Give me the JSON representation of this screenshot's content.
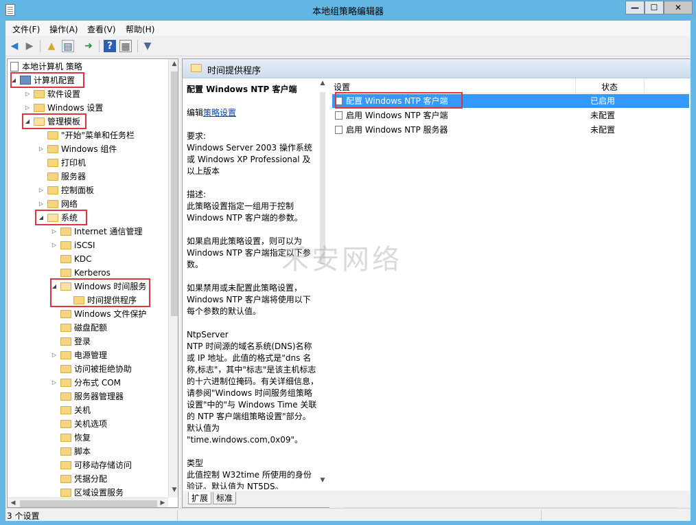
{
  "window": {
    "title": "本地组策略编辑器",
    "min_label": "—",
    "max_label": "☐",
    "close_label": "✕"
  },
  "menubar": {
    "items": [
      {
        "label": "文件(F)"
      },
      {
        "label": "操作(A)"
      },
      {
        "label": "查看(V)"
      },
      {
        "label": "帮助(H)"
      }
    ]
  },
  "toolbar": {
    "icons": [
      "back-arrow-icon",
      "forward-arrow-icon",
      "up-folder-icon",
      "show-hide-tree-icon",
      "export-list-icon",
      "help-icon",
      "properties-icon",
      "filter-icon"
    ]
  },
  "tree": {
    "root": "本地计算机 策略",
    "items": [
      {
        "label": "计算机配置"
      },
      {
        "label": "软件设置"
      },
      {
        "label": "Windows 设置"
      },
      {
        "label": "管理模板"
      },
      {
        "label": "\"开始\"菜单和任务栏"
      },
      {
        "label": "Windows 组件"
      },
      {
        "label": "打印机"
      },
      {
        "label": "服务器"
      },
      {
        "label": "控制面板"
      },
      {
        "label": "网络"
      },
      {
        "label": "系统"
      },
      {
        "label": "Internet 通信管理"
      },
      {
        "label": "iSCSI"
      },
      {
        "label": "KDC"
      },
      {
        "label": "Kerberos"
      },
      {
        "label": "Windows 时间服务"
      },
      {
        "label": "时间提供程序"
      },
      {
        "label": "Windows 文件保护"
      },
      {
        "label": "磁盘配额"
      },
      {
        "label": "登录"
      },
      {
        "label": "电源管理"
      },
      {
        "label": "访问被拒绝协助"
      },
      {
        "label": "分布式 COM"
      },
      {
        "label": "服务器管理器"
      },
      {
        "label": "关机"
      },
      {
        "label": "关机选项"
      },
      {
        "label": "恢复"
      },
      {
        "label": "脚本"
      },
      {
        "label": "可移动存储访问"
      },
      {
        "label": "凭据分配"
      },
      {
        "label": "区域设置服务"
      }
    ]
  },
  "right": {
    "header_title": "时间提供程序",
    "description": {
      "heading": "配置 Windows NTP 客户端",
      "edit_prefix": "编辑",
      "edit_link": "策略设置",
      "req_label": "要求:",
      "req_text": "Windows Server 2003 操作系统或 Windows XP Professional 及以上版本",
      "desc_label": "描述:",
      "desc_text": "此策略设置指定一组用于控制 Windows NTP 客户端的参数。",
      "p_enable": "如果启用此策略设置，则可以为 Windows NTP 客户端指定以下参数。",
      "p_disable": "如果禁用或未配置此策略设置，Windows NTP 客户端将使用以下每个参数的默认值。",
      "ntp_label": "NtpServer",
      "ntp_text": "NTP 时间源的域名系统(DNS)名称或 IP 地址。此值的格式是\"dns 名称,标志\"，其中\"标志\"是该主机标志的十六进制位掩码。有关详细信息，请参阅\"Windows 时间服务组策略设置\"中的\"与 Windows Time 关联的 NTP 客户端组策略设置\"部分。 默认值为 \"time.windows.com,0x09\"。",
      "type_label": "类型",
      "type_text": "此值控制 W32time 所使用的身份验证。默认值为 NT5DS。"
    },
    "list": {
      "col_setting": "设置",
      "col_state": "状态",
      "rows": [
        {
          "name": "配置 Windows NTP 客户端",
          "state": "已启用"
        },
        {
          "name": "启用 Windows NTP 客户端",
          "state": "未配置"
        },
        {
          "name": "启用 Windows NTP 服务器",
          "state": "未配置"
        }
      ]
    },
    "tabs": [
      {
        "label": "扩展"
      },
      {
        "label": "标准"
      }
    ]
  },
  "statusbar": {
    "text": "3 个设置"
  },
  "watermark": "禾安网络",
  "colors": {
    "selection": "#3399ff",
    "highlight_box": "#d9363e",
    "titlebar": "#62b6e4"
  }
}
